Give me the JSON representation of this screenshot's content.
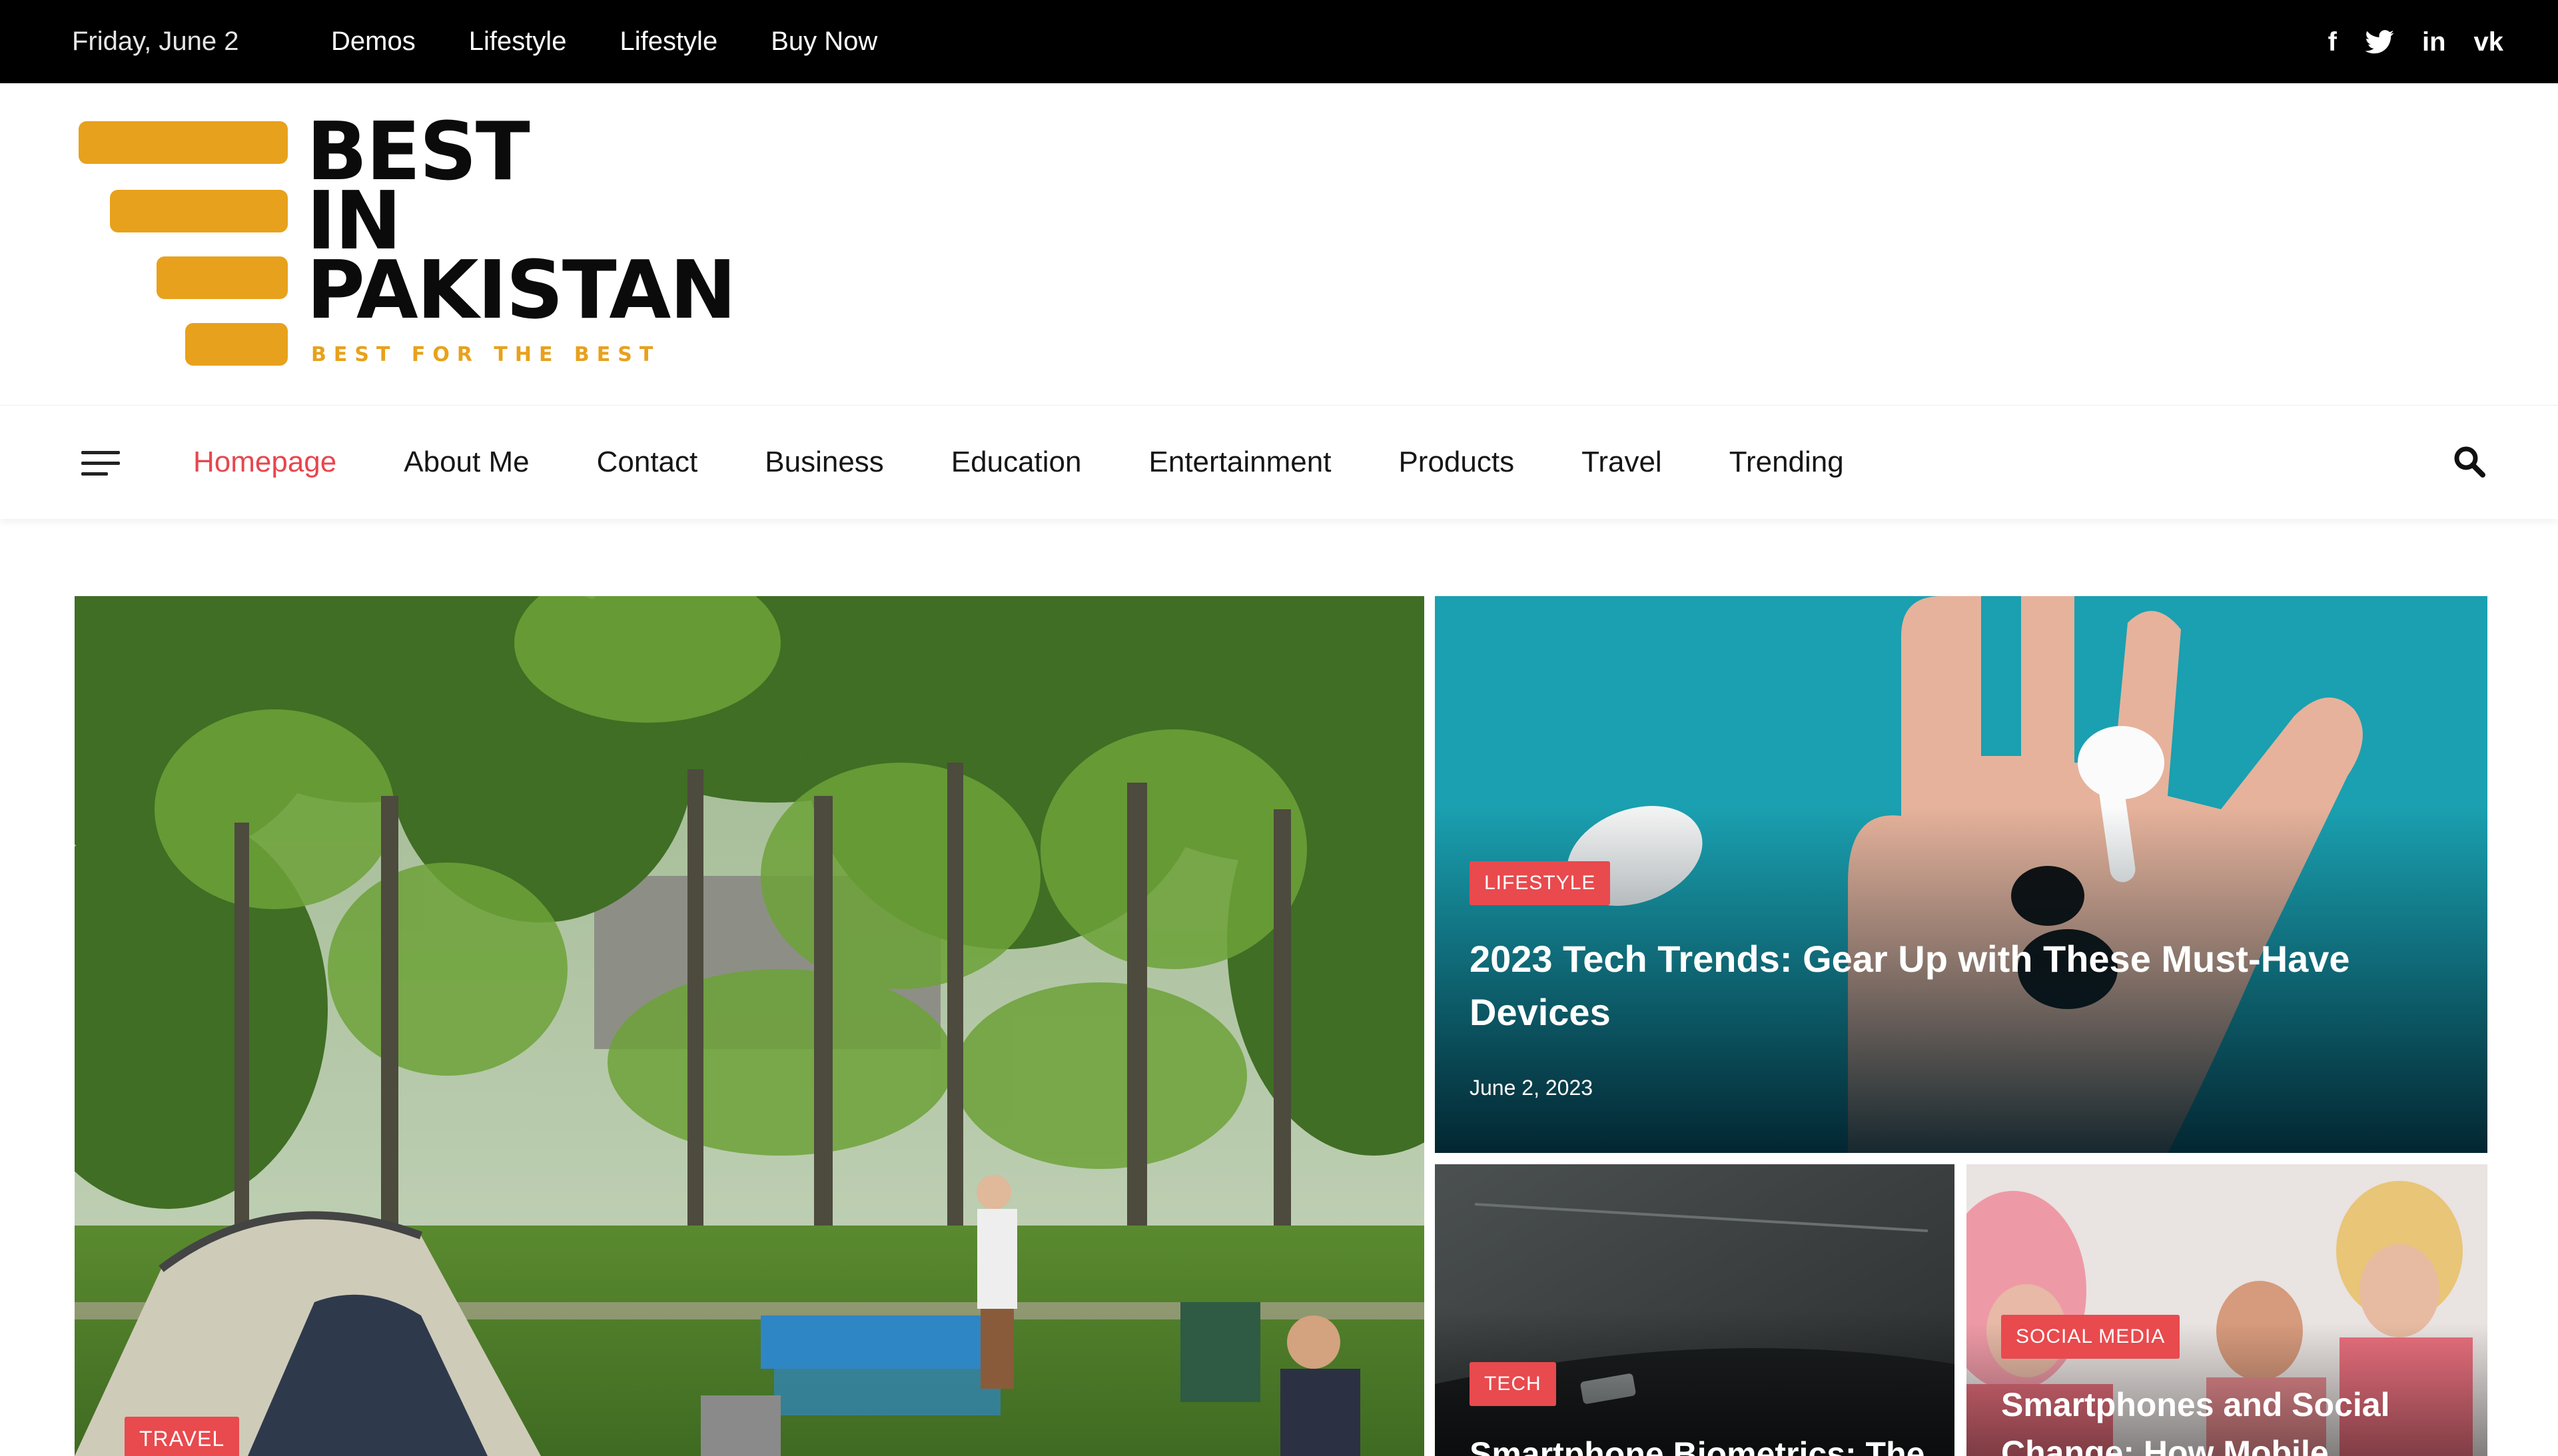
{
  "topbar": {
    "date": "Friday, June 2",
    "links": [
      "Demos",
      "Lifestyle",
      "Lifestyle",
      "Buy Now"
    ],
    "social_icons": [
      "facebook-icon",
      "twitter-icon",
      "linkedin-icon",
      "vk-icon"
    ],
    "social_glyphs": [
      "f",
      "",
      "in",
      "vk"
    ]
  },
  "logo": {
    "line1": "BEST",
    "line2": "IN",
    "line3": "PAKISTAN",
    "tagline": "BEST FOR THE BEST",
    "accent": "#E8A11C"
  },
  "nav": {
    "items": [
      "Homepage",
      "About Me",
      "Contact",
      "Business",
      "Education",
      "Entertainment",
      "Products",
      "Travel",
      "Trending"
    ],
    "active_index": 0,
    "active_color": "#E8464E"
  },
  "hero": {
    "main": {
      "category": "TRAVEL"
    },
    "featured": {
      "category": "LIFESTYLE",
      "title": "2023 Tech Trends: Gear Up with These Must-Have Devices",
      "date": "June 2, 2023"
    },
    "small_left": {
      "category": "TECH",
      "title": "Smartphone Biometrics: The"
    },
    "small_right": {
      "category": "SOCIAL MEDIA",
      "title": "Smartphones and Social Change: How Mobile"
    }
  },
  "colors": {
    "badge": "#E84A4E",
    "topbar": "#000000"
  }
}
